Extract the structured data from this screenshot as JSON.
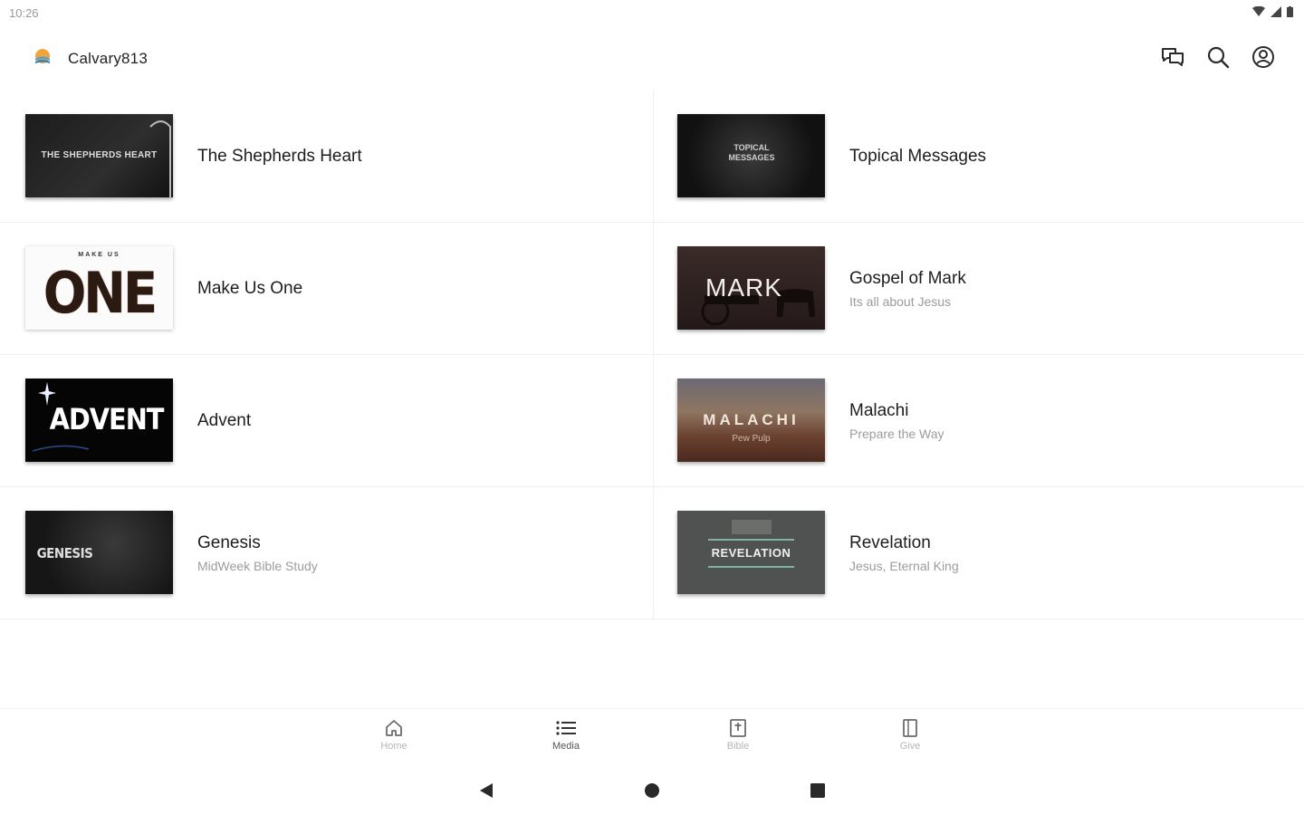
{
  "status": {
    "time": "10:26"
  },
  "app": {
    "title": "Calvary813"
  },
  "colors": {
    "accent": "#f2a33a",
    "brand_blue": "#4aa3df",
    "icon": "#2a2a2a"
  },
  "series_left": [
    {
      "title": "The Shepherds Heart",
      "subtitle": "",
      "thumb_text": "THE SHEPHERDS HEART"
    },
    {
      "title": "Make Us One",
      "subtitle": "",
      "thumb_text": "ONE",
      "thumb_kicker": "MAKE US"
    },
    {
      "title": "Advent",
      "subtitle": "",
      "thumb_text": "ADVENT"
    },
    {
      "title": "Genesis",
      "subtitle": "MidWeek Bible Study",
      "thumb_text": "GENESIS"
    }
  ],
  "series_right": [
    {
      "title": "Topical Messages",
      "subtitle": "",
      "thumb_text": "TOPICAL MESSAGES"
    },
    {
      "title": "Gospel of Mark",
      "subtitle": "Its all about Jesus",
      "thumb_text": "MARK"
    },
    {
      "title": "Malachi",
      "subtitle": "Prepare the Way",
      "thumb_text": "MALACHI",
      "thumb_sub": "Pew Pulp"
    },
    {
      "title": "Revelation",
      "subtitle": "Jesus, Eternal King",
      "thumb_text": "REVELATION"
    }
  ],
  "nav": {
    "home": "Home",
    "media": "Media",
    "bible": "Bible",
    "give": "Give"
  }
}
